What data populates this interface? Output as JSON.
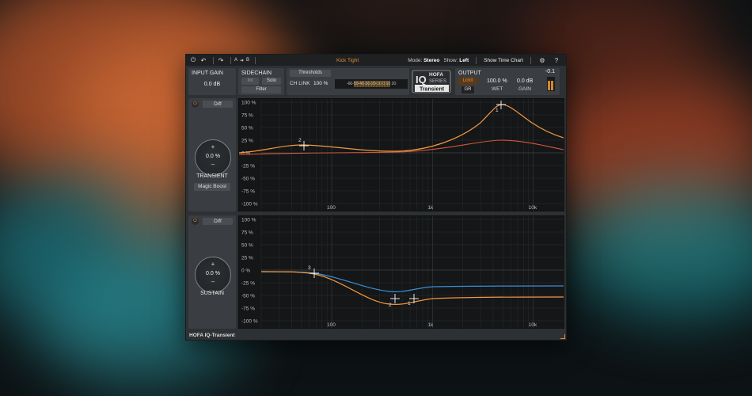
{
  "topbar": {
    "preset": "Kick Tight",
    "ab_a": "A",
    "ab_arrow": "➔",
    "ab_b": "B",
    "mode_label": "Mode:",
    "mode_value": "Stereo",
    "show_label": "Show:",
    "show_value": "Left",
    "time_chart": "Show Time Chart",
    "help": "?"
  },
  "input": {
    "title": "INPUT GAIN",
    "value": "0.0 dB"
  },
  "sidechain": {
    "title": "SIDECHAIN",
    "int": "Int",
    "solo": "Solo",
    "filter": "Filter"
  },
  "thresholds": {
    "button": "Thresholds",
    "chlink_label": "CH LINK",
    "chlink_value": "100 %",
    "meter_scale": "-60-50-40-30-20-10  0   10  20"
  },
  "logo": {
    "brand": "HOFA",
    "series_iq": "IQ",
    "series": "SERIES",
    "product": "Transient"
  },
  "output": {
    "title": "OUTPUT",
    "peak": "-0.1",
    "limit": "Limit",
    "gr": "GR",
    "wet_value": "100.0 %",
    "wet_label": "WET",
    "gain_value": "0.0 dB",
    "gain_label": "GAIN"
  },
  "transient": {
    "diff": "Diff",
    "value": "0.0 %",
    "plus": "+",
    "minus": "–",
    "label": "TRANSIENT",
    "magic": "Magic Boost"
  },
  "sustain": {
    "diff": "Diff",
    "value": "0.0 %",
    "plus": "+",
    "minus": "–",
    "label": "SUSTAIN"
  },
  "graph": {
    "y_labels": [
      "100 %",
      "75 %",
      "50 %",
      "25 %",
      "0 %",
      "-25 %",
      "-50 %",
      "-75 %",
      "-100 %"
    ],
    "x_labels": [
      "100",
      "1k",
      "10k"
    ],
    "transient_nodes": [
      "1",
      "2"
    ],
    "sustain_nodes": [
      "1",
      "2",
      "3"
    ]
  },
  "colors": {
    "accent": "#e08a30",
    "curve_orange": "#f09840",
    "curve_red": "#d0583a",
    "curve_blue": "#3a8fd6"
  },
  "footer": "HOFA IQ-Transient"
}
